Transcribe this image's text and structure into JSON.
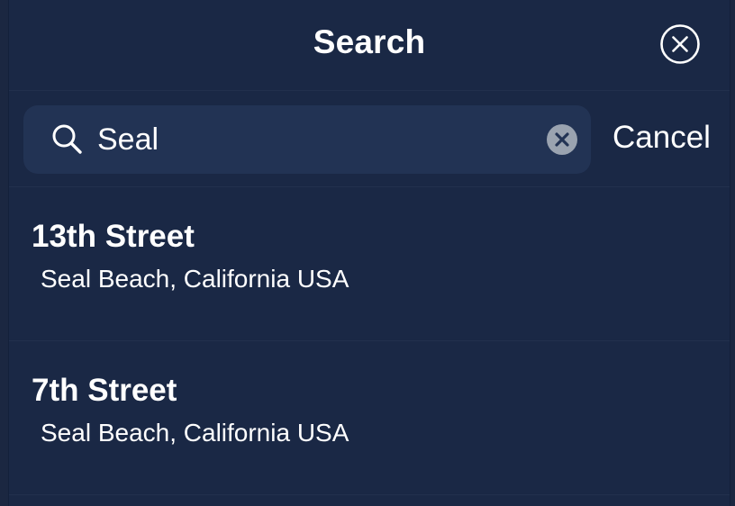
{
  "header": {
    "title": "Search",
    "close_icon": "close-circle-icon"
  },
  "search": {
    "value": "Seal",
    "search_icon": "magnifier-icon",
    "clear_icon": "clear-x-icon",
    "cancel_label": "Cancel"
  },
  "results": [
    {
      "title": "13th Street",
      "subtitle": "Seal Beach, California USA"
    },
    {
      "title": "7th Street",
      "subtitle": "Seal Beach, California USA"
    }
  ],
  "colors": {
    "background": "#1a2845",
    "search_field": "#223354",
    "text": "#ffffff",
    "clear_button": "#9aa3b0"
  }
}
